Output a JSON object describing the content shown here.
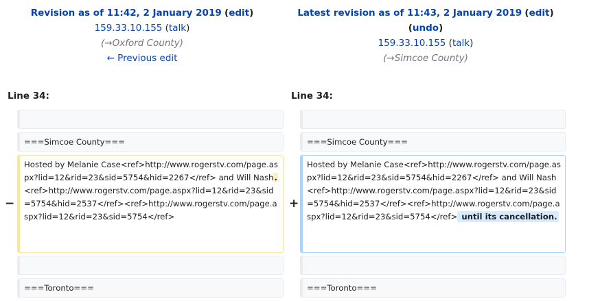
{
  "left_header": {
    "title": "Revision as of 11:42, 2 January 2019",
    "edit_label": "edit",
    "user": "159.33.10.155",
    "talk_label": "talk",
    "comment_arrow": "→",
    "comment_section": "Oxford County",
    "prev_edit_label": "← Previous edit"
  },
  "right_header": {
    "title": "Latest revision as of 11:43, 2 January 2019",
    "edit_label": "edit",
    "undo_label": "undo",
    "user": "159.33.10.155",
    "talk_label": "talk",
    "comment_arrow": "→",
    "comment_section": "Simcoe County"
  },
  "diff": {
    "left_line_label": "Line 34:",
    "right_line_label": "Line 34:",
    "removed_marker": "−",
    "added_marker": "+",
    "context_heading_1": "===Simcoe County===",
    "context_heading_2": "===Toronto===",
    "removed_text": "Hosted by Melanie Case<ref>http://www.rogerstv.com/page.aspx?lid=12&rid=23&sid=5754&hid=2267</ref> and Will Nash",
    "removed_highlight": ".",
    "removed_text_after": "<ref>http://www.rogerstv.com/page.aspx?lid=12&rid=23&sid=5754&hid=2537</ref><ref>http://www.rogerstv.com/page.aspx?lid=12&rid=23&sid=5754</ref>",
    "added_text": "Hosted by Melanie Case<ref>http://www.rogerstv.com/page.aspx?lid=12&rid=23&sid=5754&hid=2267</ref> and Will Nash<ref>http://www.rogerstv.com/page.aspx?lid=12&rid=23&sid=5754&hid=2537</ref><ref>http://www.rogerstv.com/page.aspx?lid=12&rid=23&sid=5754</ref>",
    "added_highlight": " until its cancellation."
  }
}
